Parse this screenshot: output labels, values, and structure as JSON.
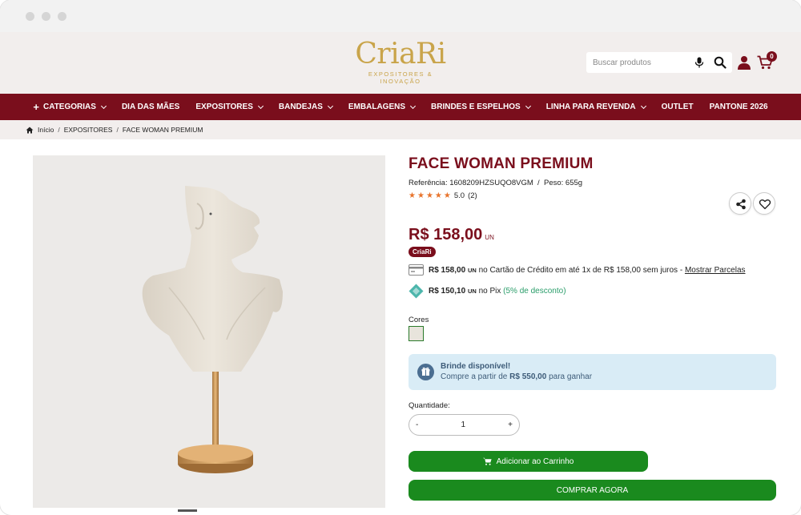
{
  "brand": {
    "logo_text": "CriaRi",
    "logo_tagline": "EXPOSITORES & INOVAÇÃO",
    "gold": "#c9a44a",
    "primary": "#7a0e1c",
    "green": "#1a8a1e"
  },
  "search": {
    "placeholder": "Buscar produtos"
  },
  "cart": {
    "count": "0"
  },
  "nav": {
    "items": [
      {
        "label": "CATEGORIAS",
        "plus": true,
        "dropdown": true
      },
      {
        "label": "DIA DAS MÃES",
        "dropdown": false
      },
      {
        "label": "EXPOSITORES",
        "dropdown": true
      },
      {
        "label": "BANDEJAS",
        "dropdown": true
      },
      {
        "label": "EMBALAGENS",
        "dropdown": true
      },
      {
        "label": "BRINDES E ESPELHOS",
        "dropdown": true
      },
      {
        "label": "LINHA PARA REVENDA",
        "dropdown": true
      },
      {
        "label": "OUTLET",
        "dropdown": false
      },
      {
        "label": "PANTONE 2026",
        "dropdown": false
      }
    ]
  },
  "breadcrumb": {
    "home": "Início",
    "category": "EXPOSITORES",
    "current": "FACE WOMAN PREMIUM",
    "sep": "/"
  },
  "product": {
    "title": "FACE WOMAN PREMIUM",
    "reference": "Referência: 1608209HZSUQO8VGM",
    "weight": "Peso: 655g",
    "rating_value": "5.0",
    "rating_count": "(2)",
    "stars": 5,
    "price": "R$ 158,00",
    "price_unit": "UN",
    "brand_badge": "CriaRi"
  },
  "payment": {
    "card_amount": "R$ 158,00",
    "card_unit": "UN",
    "card_text": "no Cartão de Crédito em até 1x de R$ 158,00 sem juros -",
    "card_link": "Mostrar Parcelas",
    "pix_amount": "R$ 150,10",
    "pix_unit": "UN",
    "pix_text": "no Pix",
    "pix_discount": "(5% de desconto)"
  },
  "options": {
    "colors_label": "Cores"
  },
  "gift": {
    "title": "Brinde disponível!",
    "text_prefix": "Compre a partir de",
    "amount": "R$ 550,00",
    "text_suffix": "para ganhar"
  },
  "quantity": {
    "label": "Quantidade:",
    "value": "1",
    "minus": "-",
    "plus": "+"
  },
  "buttons": {
    "add_to_cart": "Adicionar ao Carrinho",
    "buy_now": "COMPRAR AGORA"
  }
}
